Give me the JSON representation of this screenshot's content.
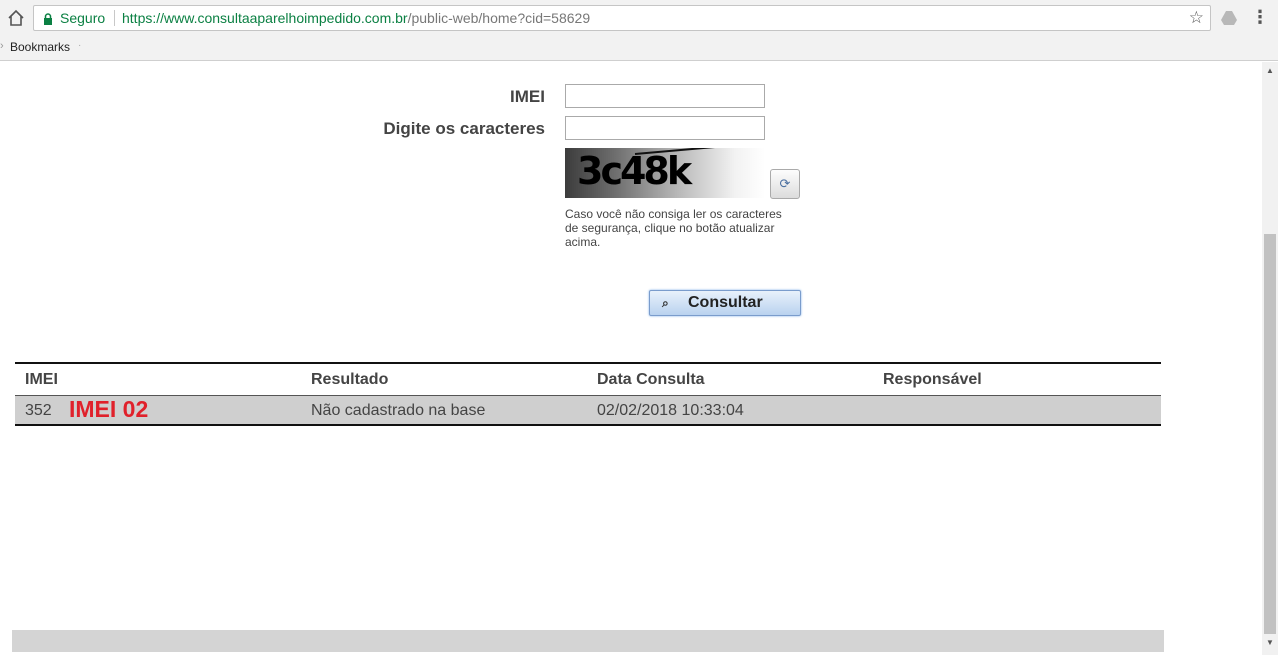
{
  "browser": {
    "secure_label": "Seguro",
    "url_domain": "https://www.consultaaparelhoimpedido.com.br",
    "url_path": "/public-web/home?cid=58629",
    "bookmarks_label": "Bookmarks"
  },
  "form": {
    "imei_label": "IMEI",
    "imei_value": "",
    "chars_label": "Digite os caracteres",
    "chars_value": "",
    "captcha_text": "3c48k",
    "captcha_help": "Caso você não consiga ler os caracteres de segurança, clique no botão atualizar acima.",
    "submit_label": "Consultar"
  },
  "results": {
    "columns": [
      "IMEI",
      "Resultado",
      "Data Consulta",
      "Responsável"
    ],
    "rows": [
      {
        "imei": "352",
        "overlay": "IMEI 02",
        "resultado": "Não cadastrado na base",
        "data": "02/02/2018 10:33:04",
        "responsavel": ""
      }
    ]
  },
  "colors": {
    "secure_green": "#0b8043",
    "overlay_red": "#e0212b",
    "row_bg": "#cfcfcf"
  }
}
